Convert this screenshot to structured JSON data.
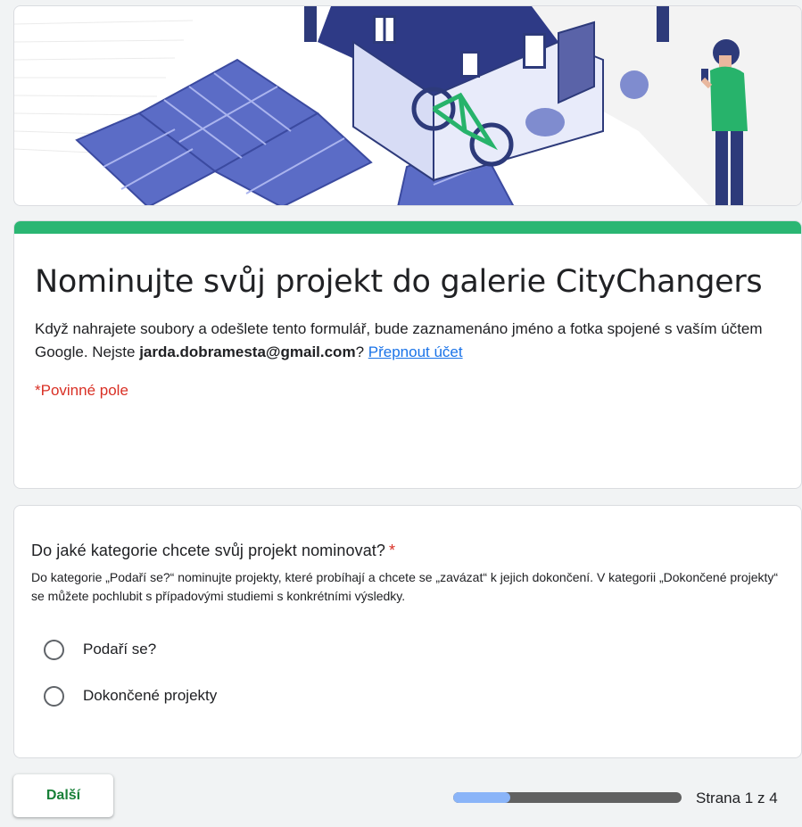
{
  "form": {
    "title": "Nominujte svůj projekt do galerie CityChangers",
    "description_before": "Když nahrajete soubory a odešlete tento formulář, bude zaznamenáno jméno a fotka spojené s vaším účtem Google. Nejste ",
    "account_email": "jarda.dobramesta@gmail.com",
    "description_after": "? ",
    "switch_account_link": "Přepnout účet",
    "required_note": "*Povinné pole",
    "accent_color": "#2bb673"
  },
  "banner": {
    "illustration": "house-with-solar-panels-bicycle-and-man-with-phone"
  },
  "question": {
    "title": "Do jaké kategorie chcete svůj projekt nominovat?",
    "required_marker": "*",
    "help_text": "Do kategorie „Podaří se?“ nominujte projekty, které probíhají a chcete se „zavázat“ k jejich dokončení. V kategorii „Dokončené projekty“ se můžete pochlubit s případovými studiemi s konkrétními výsledky.",
    "options": [
      {
        "label": "Podaří se?",
        "selected": false
      },
      {
        "label": "Dokončené projekty",
        "selected": false
      }
    ]
  },
  "footer": {
    "next_label": "Další",
    "page_indicator": "Strana 1 z 4",
    "progress_fraction": 0.25
  }
}
